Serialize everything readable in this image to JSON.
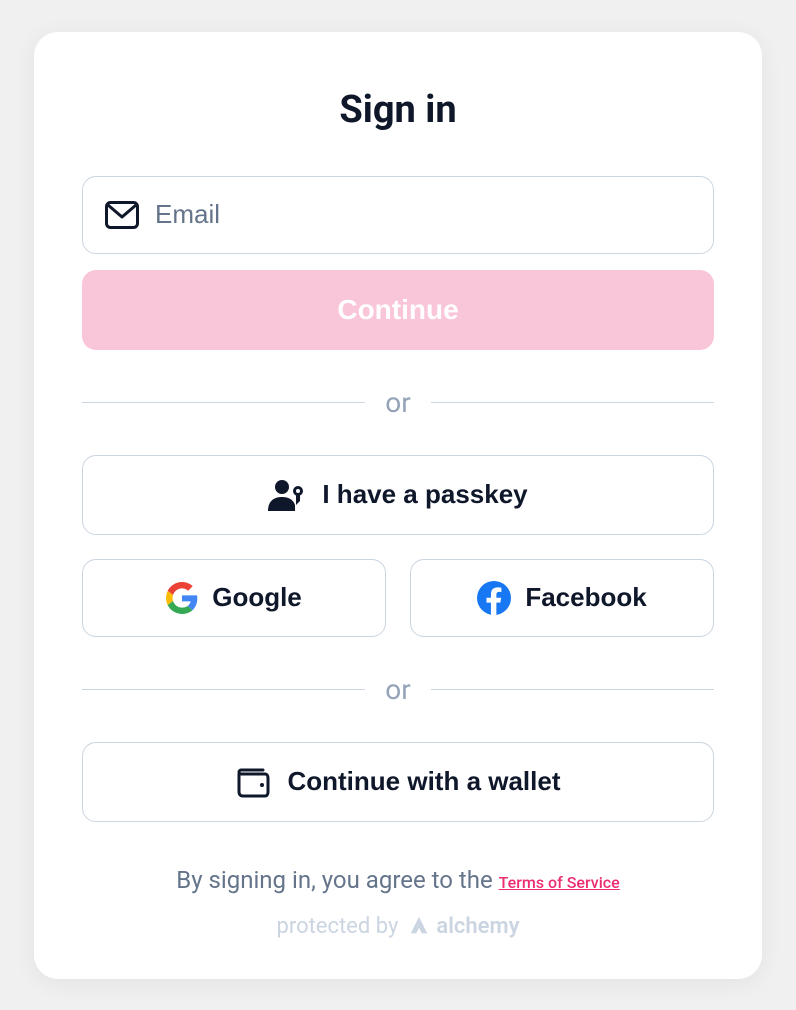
{
  "title": "Sign in",
  "email": {
    "placeholder": "Email",
    "value": ""
  },
  "buttons": {
    "continue": "Continue",
    "passkey": "I have a passkey",
    "google": "Google",
    "facebook": "Facebook",
    "wallet": "Continue with a wallet"
  },
  "dividers": {
    "or1": "or",
    "or2": "or"
  },
  "footer": {
    "legal_prefix": "By signing in, you agree to the ",
    "legal_link": "Terms of Service",
    "protected_prefix": "protected by",
    "protected_brand": "alchemy"
  },
  "colors": {
    "accent": "#ec2d73",
    "continue_bg": "#f9c5d9"
  }
}
